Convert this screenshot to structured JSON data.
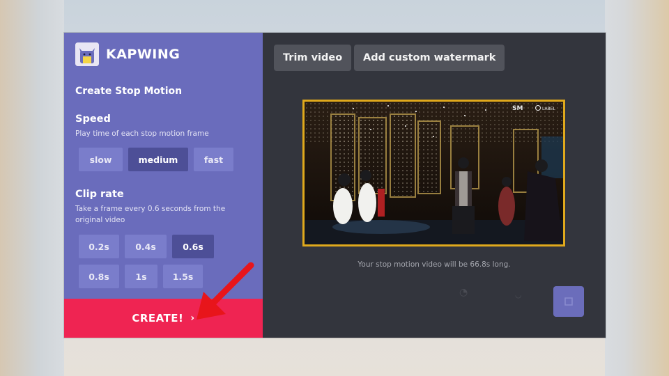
{
  "brand": {
    "name": "KAPWING"
  },
  "sidebar": {
    "heading": "Create Stop Motion",
    "speed": {
      "title": "Speed",
      "description": "Play time of each stop motion frame",
      "options": [
        "slow",
        "medium",
        "fast"
      ],
      "selected": "medium"
    },
    "clip_rate": {
      "title": "Clip rate",
      "description": "Take a frame every 0.6 seconds from the original video",
      "options": [
        "0.2s",
        "0.4s",
        "0.6s",
        "0.8s",
        "1s",
        "1.5s"
      ],
      "selected": "0.6s"
    },
    "create_label": "CREATE!",
    "create_chevron": "›"
  },
  "toolbar": {
    "trim_label": "Trim video",
    "watermark_label": "Add custom watermark"
  },
  "preview": {
    "duration_text": "Your stop motion video will be 66.8s long.",
    "overlay_logo_1": "SM",
    "overlay_logo_2": "LABEL"
  },
  "colors": {
    "sidebar": "#6a6cbc",
    "create": "#ef2452",
    "main": "#33353d",
    "preview_border": "#e0a91c",
    "annotation_arrow": "#e8151b"
  },
  "icons": {
    "logo": "kapwing-cat-icon",
    "create_chevron": "chevron-right-icon",
    "corner": "square-icon",
    "annotation": "red-arrow-icon"
  }
}
